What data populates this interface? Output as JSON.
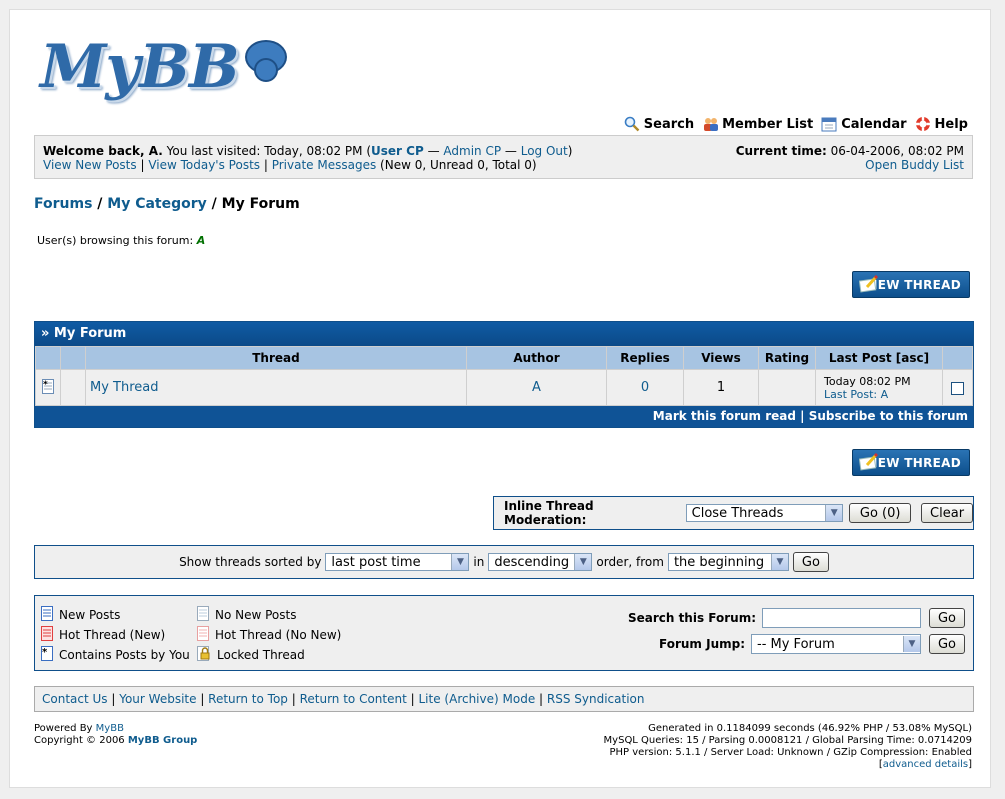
{
  "logo": {
    "text": "MyBB"
  },
  "top_menu": [
    {
      "label": "Search",
      "icon": "search-icon"
    },
    {
      "label": "Member List",
      "icon": "members-icon"
    },
    {
      "label": "Calendar",
      "icon": "calendar-icon"
    },
    {
      "label": "Help",
      "icon": "help-icon"
    }
  ],
  "welcome": {
    "prefix": "Welcome back, ",
    "user": "A.",
    "visited": " You last visited: Today, 08:02 PM (",
    "user_cp": "User CP",
    "sep1": " — ",
    "admin_cp": "Admin CP",
    "sep2": " — ",
    "logout": "Log Out",
    "close": ")",
    "view_new": "View New Posts",
    "view_today": "View Today's Posts",
    "pms": "Private Messages",
    "pm_counts": " (New 0, Unread 0, Total 0)",
    "current_time_label": "Current time:",
    "current_time": " 06-04-2006, 08:02 PM",
    "buddy_list": "Open Buddy List"
  },
  "breadcrumb": {
    "forums": "Forums",
    "sep": " / ",
    "category": "My Category",
    "current": "My Forum"
  },
  "browsing": {
    "label": "User(s) browsing this forum: ",
    "user": "A"
  },
  "new_thread_label": "NEW THREAD",
  "forum_table": {
    "title": "» My Forum",
    "columns": [
      "Thread",
      "Author",
      "Replies",
      "Views",
      "Rating",
      "Last Post [asc]"
    ],
    "rows": [
      {
        "thread": "My Thread",
        "author": "A",
        "replies": "0",
        "views": "1",
        "rating": "",
        "last_post_time": "Today 08:02 PM",
        "last_post_label": "Last Post: ",
        "last_post_author": "A"
      }
    ],
    "footer_mark_read": "Mark this forum read",
    "footer_sep": " | ",
    "footer_subscribe": "Subscribe to this forum"
  },
  "moderation": {
    "label": "Inline Thread Moderation:",
    "selected": "Close Threads",
    "go": "Go (0)",
    "clear": "Clear"
  },
  "sort": {
    "label": "Show threads sorted by",
    "by": "last post time",
    "in": "in",
    "order": "descending",
    "order_label": "order, from",
    "from": "the beginning",
    "go": "Go"
  },
  "legend": {
    "new_posts": "New Posts",
    "no_new_posts": "No New Posts",
    "hot_new": "Hot Thread (New)",
    "hot_no_new": "Hot Thread (No New)",
    "contains_yours": "Contains Posts by You",
    "locked": "Locked Thread"
  },
  "search_forum": {
    "label": "Search this Forum:",
    "value": "",
    "go": "Go"
  },
  "forum_jump": {
    "label": "Forum Jump:",
    "selected": "-- My Forum",
    "go": "Go"
  },
  "footer_links": [
    "Contact Us",
    "Your Website",
    "Return to Top",
    "Return to Content",
    "Lite (Archive) Mode",
    "RSS Syndication"
  ],
  "powered": {
    "label": "Powered By ",
    "mybb": "MyBB",
    "copyright": "Copyright © 2006 ",
    "group": "MyBB Group"
  },
  "stats": {
    "line1": "Generated in 0.1184099 seconds (46.92% PHP / 53.08% MySQL)",
    "line2": "MySQL Queries: 15 / Parsing 0.0008121 / Global Parsing Time: 0.0714209",
    "line3": "PHP version: 5.1.1 / Server Load: Unknown / GZip Compression: Enabled",
    "advanced": "advanced details"
  },
  "colors": {
    "header_blue": "#0f5ba4",
    "link": "#0f5c8e",
    "cat_bg": "#a7c4e2",
    "panel_bg": "#efefef"
  }
}
